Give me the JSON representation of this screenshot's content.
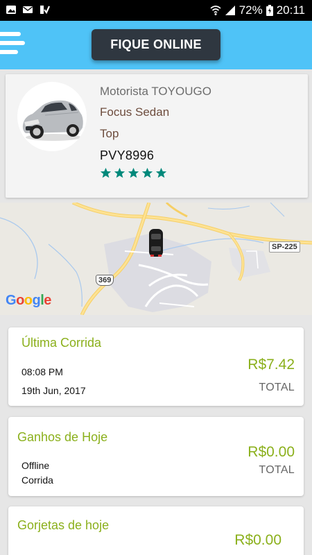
{
  "status_bar": {
    "battery": "72%",
    "time": "20:11"
  },
  "header": {
    "online_button": "FIQUE ONLINE"
  },
  "driver": {
    "name": "Motorista TOYOUGO",
    "car_model": "Focus Sedan",
    "category": "Top",
    "plate": "PVY8996",
    "rating": 5
  },
  "map": {
    "provider": "Google",
    "road_labels": [
      "SP-225",
      "369"
    ]
  },
  "last_ride": {
    "title": "Última Corrida",
    "time": "08:08 PM",
    "date": "19th Jun, 2017",
    "amount": "R$7.42",
    "total_label": "TOTAL"
  },
  "today_earnings": {
    "title": "Ganhos de Hoje",
    "line1": "Offline",
    "line2": "Corrida",
    "amount": "R$0.00",
    "total_label": "TOTAL"
  },
  "today_tips": {
    "title": "Gorjetas de hoje",
    "amount": "R$0.00"
  },
  "colors": {
    "header": "#4fc3f7",
    "button": "#2f3740",
    "accent_green": "#8bb01c",
    "star": "#00897b",
    "car_text": "#6d4c3d"
  }
}
